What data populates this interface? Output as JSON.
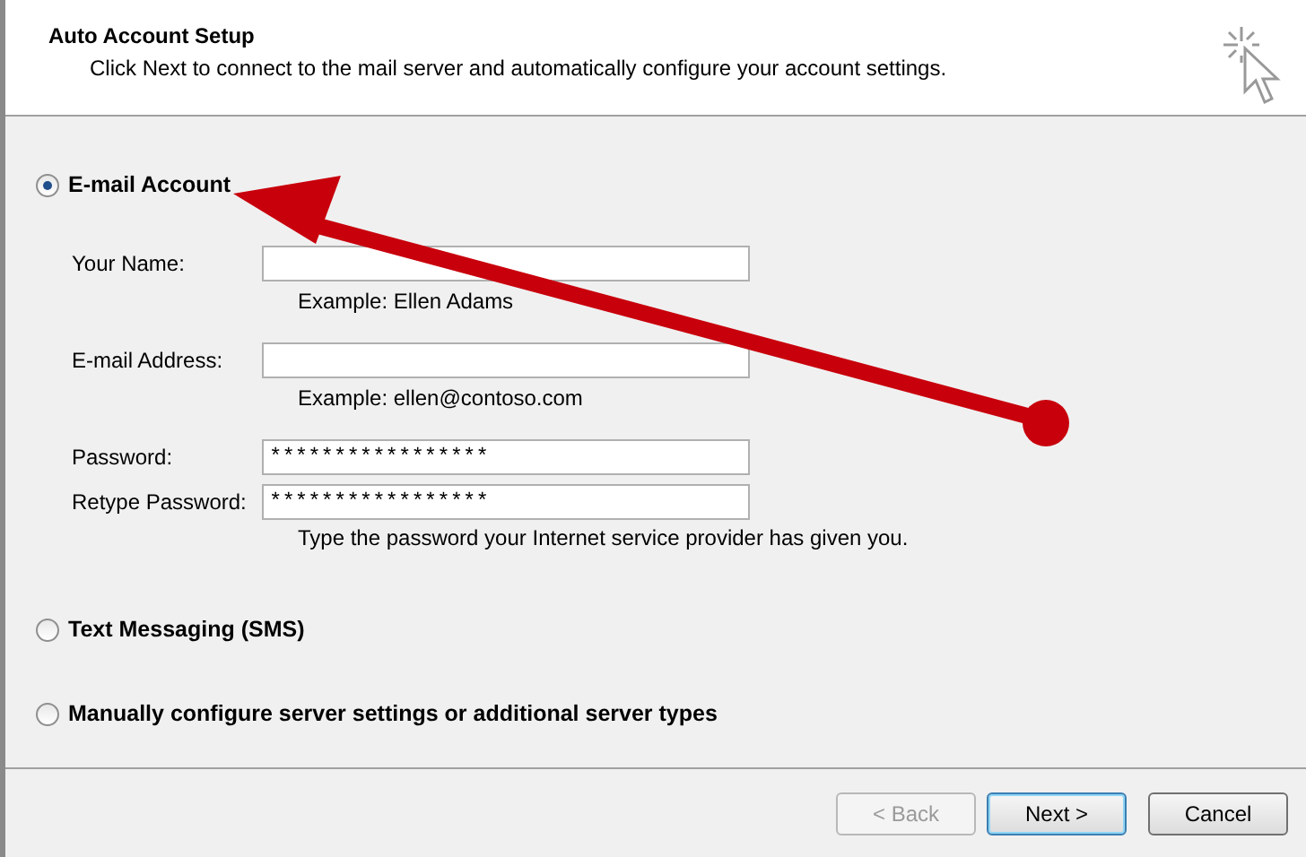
{
  "header": {
    "title": "Auto Account Setup",
    "subtitle": "Click Next to connect to the mail server and automatically configure your account settings."
  },
  "options": [
    {
      "label": "E-mail Account",
      "selected": true,
      "fields": [
        {
          "label": "Your Name:",
          "hint": "Example: Ellen Adams"
        },
        {
          "label": "E-mail Address:",
          "hint": "Example: ellen@contoso.com"
        },
        {
          "label": "Password:",
          "value": "*****************"
        },
        {
          "label": "Retype Password:",
          "value": "*****************",
          "hint": "Type the password your Internet service provider has given you."
        }
      ]
    },
    {
      "label": "Text Messaging (SMS)",
      "selected": false
    },
    {
      "label": "Manually configure server settings or additional server types",
      "selected": false
    }
  ],
  "buttons": [
    {
      "label": "< Back",
      "disabled": true,
      "default": false
    },
    {
      "label": "Next >",
      "disabled": false,
      "default": true
    },
    {
      "label": "Cancel",
      "disabled": false,
      "default": false
    }
  ]
}
